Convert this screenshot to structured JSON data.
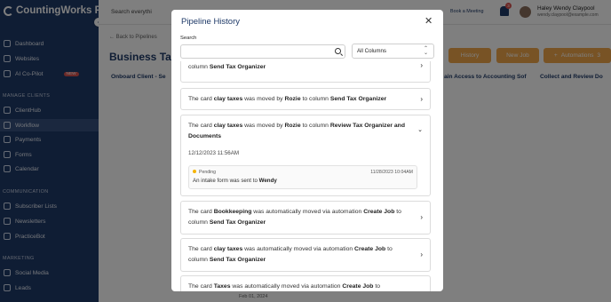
{
  "app": {
    "brand": "CountingWorks PRO",
    "nav": [
      {
        "label": "Dashboard"
      },
      {
        "label": "Websites"
      },
      {
        "label": "AI Co-Pilot",
        "badge": "NEW"
      },
      {
        "section": "MANAGE CLIENTS"
      },
      {
        "label": "ClientHub"
      },
      {
        "label": "Workflow",
        "active": true
      },
      {
        "label": "Payments"
      },
      {
        "label": "Forms"
      },
      {
        "label": "Calendar"
      },
      {
        "section": "COMMUNICATION"
      },
      {
        "label": "Subscriber Lists"
      },
      {
        "label": "Newsletters"
      },
      {
        "label": "PracticeBot"
      },
      {
        "section": "MARKETING"
      },
      {
        "label": "Social Media"
      },
      {
        "label": "Leads"
      }
    ]
  },
  "topbar": {
    "search_text": "Search everythi",
    "meeting_link": "Book a Meeting",
    "notification_count": "3",
    "user_name": "Haley Wendy Claypool",
    "user_email": "wendy.claypool@example.com"
  },
  "main": {
    "back_link": "Back to Pipelines",
    "page_title": "Business Tax",
    "buttons": {
      "history": "History",
      "new_job": "New Job",
      "automations": "Automations"
    },
    "automations_count": "3",
    "columns": [
      "Onboard Client - Se",
      "ain Access to Accounting Sof",
      "Collect and Review Do"
    ],
    "date_fragment": "Feb 01, 2024"
  },
  "modal": {
    "title": "Pipeline History",
    "search_label": "Search",
    "search_value": "",
    "filter_selected": "All Columns",
    "entries": [
      {
        "t1": "",
        "t2": "",
        "t3": "",
        "t4": "",
        "t5": "",
        "t6": "column ",
        "t7": "Send Tax Organizer"
      },
      {
        "t1": "The card ",
        "t2": "clay taxes",
        "t3": " was moved by ",
        "t4": "Rozie",
        "t5": "",
        "t6": " to column ",
        "t7": "Send Tax Organizer"
      },
      {
        "t1": "The card ",
        "t2": "clay taxes",
        "t3": " was moved by ",
        "t4": "Rozie",
        "t5": "",
        "t6": " to column ",
        "t7": "Review Tax Organizer and Documents",
        "date": "12/12/2023 11:56AM",
        "detail": {
          "status": "Pending",
          "date": "11/28/2023 10:04AM",
          "message_pre": "An intake form was sent to ",
          "message_name": "Wendy"
        }
      },
      {
        "t1": "The card ",
        "t2": "Bookkeeping",
        "t3": " was automatically moved via automation ",
        "t4": "Create Job",
        "t5": "",
        "t6": " to column ",
        "t7": "Send Tax Organizer"
      },
      {
        "t1": "The card ",
        "t2": "clay taxes",
        "t3": " was automatically moved via automation ",
        "t4": "Create Job",
        "t5": "",
        "t6": " to column ",
        "t7": "Send Tax Organizer"
      },
      {
        "t1": "The card ",
        "t2": "Taxes",
        "t3": " was automatically moved via automation ",
        "t4": "Create Job",
        "t5": "",
        "t6": " to",
        "t7": ""
      }
    ]
  }
}
